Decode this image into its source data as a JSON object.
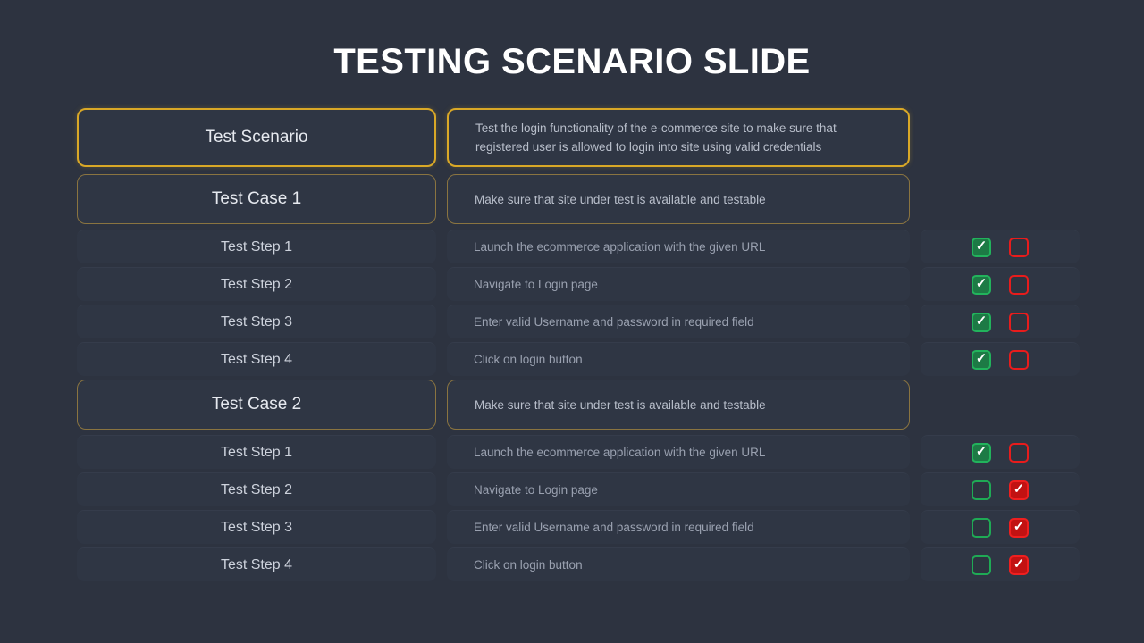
{
  "title": "TESTING SCENARIO SLIDE",
  "colors": {
    "background": "#2d3340",
    "cell": "#2f3644",
    "scenario_border": "#d9a827",
    "case_border": "#8a7440",
    "green": "#22b35c",
    "red": "#ef1f1f",
    "title_text": "#ffffff"
  },
  "icons": {
    "check": "✓"
  },
  "scenario": {
    "label": "Test Scenario",
    "description": "Test the login functionality of the e-commerce site to make sure that registered user is allowed to login into site using valid credentials"
  },
  "cases": [
    {
      "label": "Test Case 1",
      "description": "Make sure that site under test is available and testable",
      "steps": [
        {
          "label": "Test Step 1",
          "description": "Launch the ecommerce application with the given URL",
          "pass": true,
          "fail": false
        },
        {
          "label": "Test Step 2",
          "description": "Navigate to Login page",
          "pass": true,
          "fail": false
        },
        {
          "label": "Test Step 3",
          "description": "Enter valid Username and password in required field",
          "pass": true,
          "fail": false
        },
        {
          "label": "Test Step 4",
          "description": "Click on login button",
          "pass": true,
          "fail": false
        }
      ]
    },
    {
      "label": "Test Case 2",
      "description": "Make sure that site under test is available and testable",
      "steps": [
        {
          "label": "Test Step 1",
          "description": "Launch the ecommerce application with the given URL",
          "pass": true,
          "fail": false
        },
        {
          "label": "Test Step 2",
          "description": "Navigate to Login page",
          "pass": false,
          "fail": true
        },
        {
          "label": "Test Step 3",
          "description": "Enter valid Username and password in required field",
          "pass": false,
          "fail": true
        },
        {
          "label": "Test Step 4",
          "description": "Click on login button",
          "pass": false,
          "fail": true
        }
      ]
    }
  ]
}
